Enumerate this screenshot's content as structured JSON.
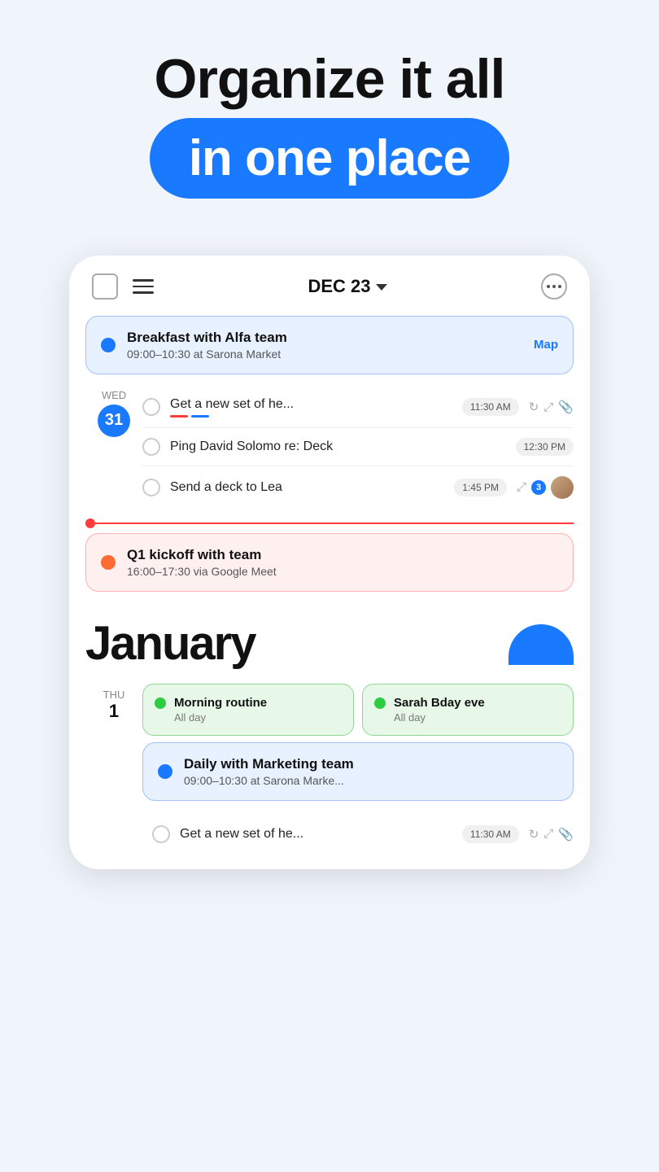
{
  "hero": {
    "line1": "Organize it all",
    "line2": "in one place"
  },
  "header": {
    "date": "DEC 23",
    "more_icon": "···"
  },
  "dec_events": {
    "featured": {
      "title": "Breakfast with Alfa team",
      "subtitle": "09:00–10:30 at Sarona Market",
      "map_label": "Map"
    },
    "day_name": "WED",
    "day_num": "31",
    "tasks": [
      {
        "text": "Get a new set of he...",
        "time": "11:30 AM",
        "has_bars": true,
        "has_repeat": true,
        "has_share": true,
        "has_clip": true
      },
      {
        "text": "Ping David Solomo re: Deck",
        "time": "12:30 PM",
        "has_bars": false
      },
      {
        "text": "Send a deck to Lea",
        "time": "1:45 PM",
        "has_share": true,
        "has_comment": "3",
        "has_avatar": true
      }
    ]
  },
  "kickoff": {
    "title": "Q1 kickoff with team",
    "subtitle": "16:00–17:30 via Google Meet"
  },
  "january": {
    "month": "January",
    "day_name": "THU",
    "day_num": "1",
    "allday_events": [
      {
        "title": "Morning routine",
        "subtitle": "All day"
      },
      {
        "title": "Sarah Bday eve",
        "subtitle": "All day"
      }
    ],
    "daily_event": {
      "title": "Daily with Marketing team",
      "subtitle": "09:00–10:30 at Sarona Marke..."
    },
    "bottom_task": {
      "text": "Get a new set of he...",
      "time": "11:30 AM"
    }
  }
}
